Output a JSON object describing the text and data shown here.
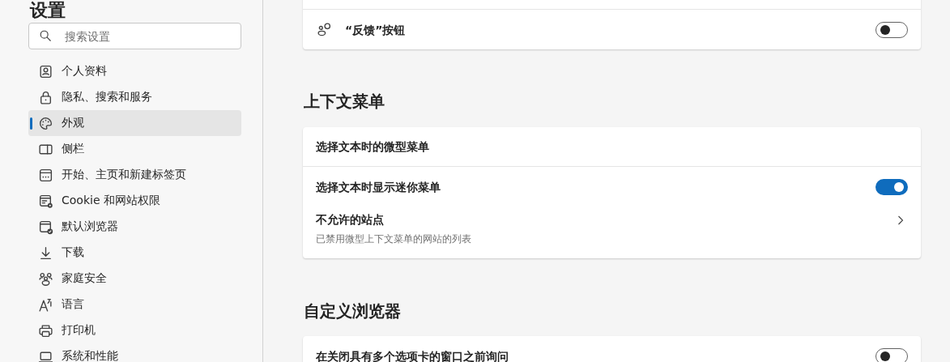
{
  "page_title": "设置",
  "search": {
    "placeholder": "搜索设置"
  },
  "nav": [
    {
      "label": "个人资料",
      "selected": false
    },
    {
      "label": "隐私、搜索和服务",
      "selected": false
    },
    {
      "label": "外观",
      "selected": true
    },
    {
      "label": "侧栏",
      "selected": false
    },
    {
      "label": "开始、主页和新建标签页",
      "selected": false
    },
    {
      "label": "Cookie 和网站权限",
      "selected": false
    },
    {
      "label": "默认浏览器",
      "selected": false
    },
    {
      "label": "下载",
      "selected": false
    },
    {
      "label": "家庭安全",
      "selected": false
    },
    {
      "label": "语言",
      "selected": false
    },
    {
      "label": "打印机",
      "selected": false
    },
    {
      "label": "系统和性能",
      "selected": false
    }
  ],
  "sections": [
    {
      "rows": [
        {
          "kind": "toggle",
          "label": "“反馈”按钮",
          "on": false
        }
      ]
    },
    {
      "heading": "上下文菜单",
      "rows": [
        {
          "kind": "header",
          "label": "选择文本时的微型菜单"
        },
        {
          "kind": "toggle",
          "label": "选择文本时显示迷你菜单",
          "on": true
        },
        {
          "kind": "link",
          "label": "不允许的站点",
          "description": "已禁用微型上下文菜单的网站的列表"
        }
      ]
    },
    {
      "heading": "自定义浏览器",
      "rows": [
        {
          "kind": "toggle",
          "label": "在关闭具有多个选项卡的窗口之前询问",
          "on": false
        }
      ]
    }
  ]
}
